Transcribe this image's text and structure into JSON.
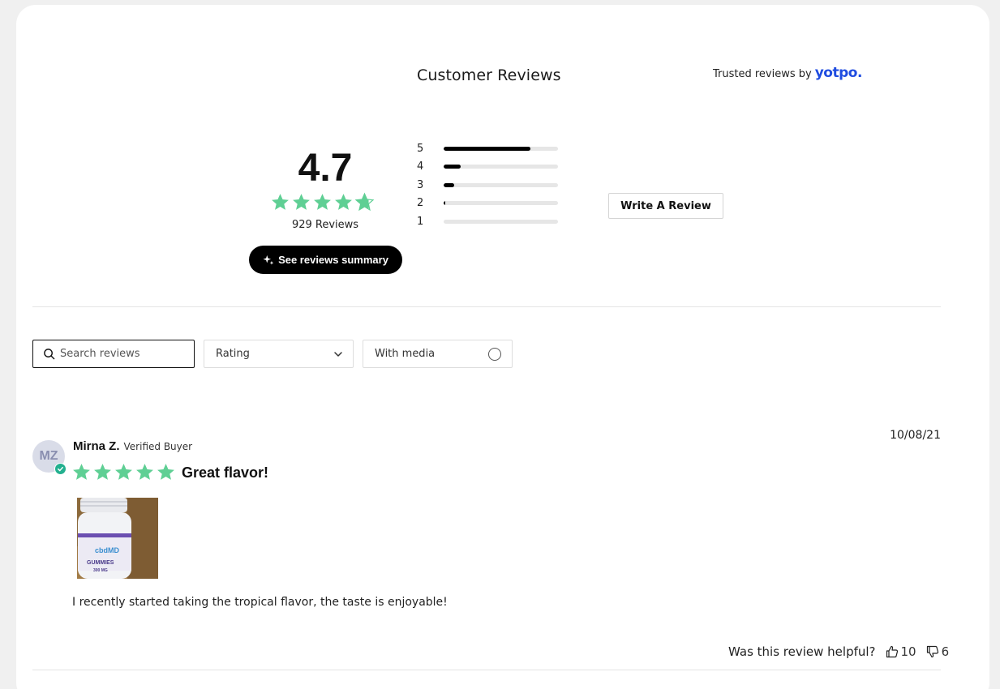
{
  "header": {
    "title": "Customer Reviews",
    "trusted_prefix": "Trusted reviews by",
    "trusted_brand": "yotpo."
  },
  "summary": {
    "average": "4.7",
    "average_rating": 4.7,
    "review_count_label": "929 Reviews",
    "summary_button_label": "See reviews summary",
    "distribution": [
      {
        "stars": "5",
        "fraction": 0.76
      },
      {
        "stars": "4",
        "fraction": 0.15
      },
      {
        "stars": "3",
        "fraction": 0.09
      },
      {
        "stars": "2",
        "fraction": 0.01
      },
      {
        "stars": "1",
        "fraction": 0.0
      }
    ],
    "write_button_label": "Write A Review"
  },
  "filters": {
    "search_placeholder": "Search reviews",
    "rating_label": "Rating",
    "media_label": "With media"
  },
  "review": {
    "initials": "MZ",
    "name": "Mirna Z.",
    "verified_label": "Verified Buyer",
    "date": "10/08/21",
    "rating": 5,
    "title": "Great flavor!",
    "body": "I recently started taking the tropical flavor, the taste is enjoyable!",
    "helpful_question": "Was this review helpful?",
    "upvotes": "10",
    "downvotes": "6",
    "image_brand": "cbdMD",
    "image_product": "GUMMIES",
    "image_strength": "300 MG"
  },
  "colors": {
    "star": "#5fcf94",
    "accent": "#1f4ce0",
    "verified": "#23b08f"
  }
}
